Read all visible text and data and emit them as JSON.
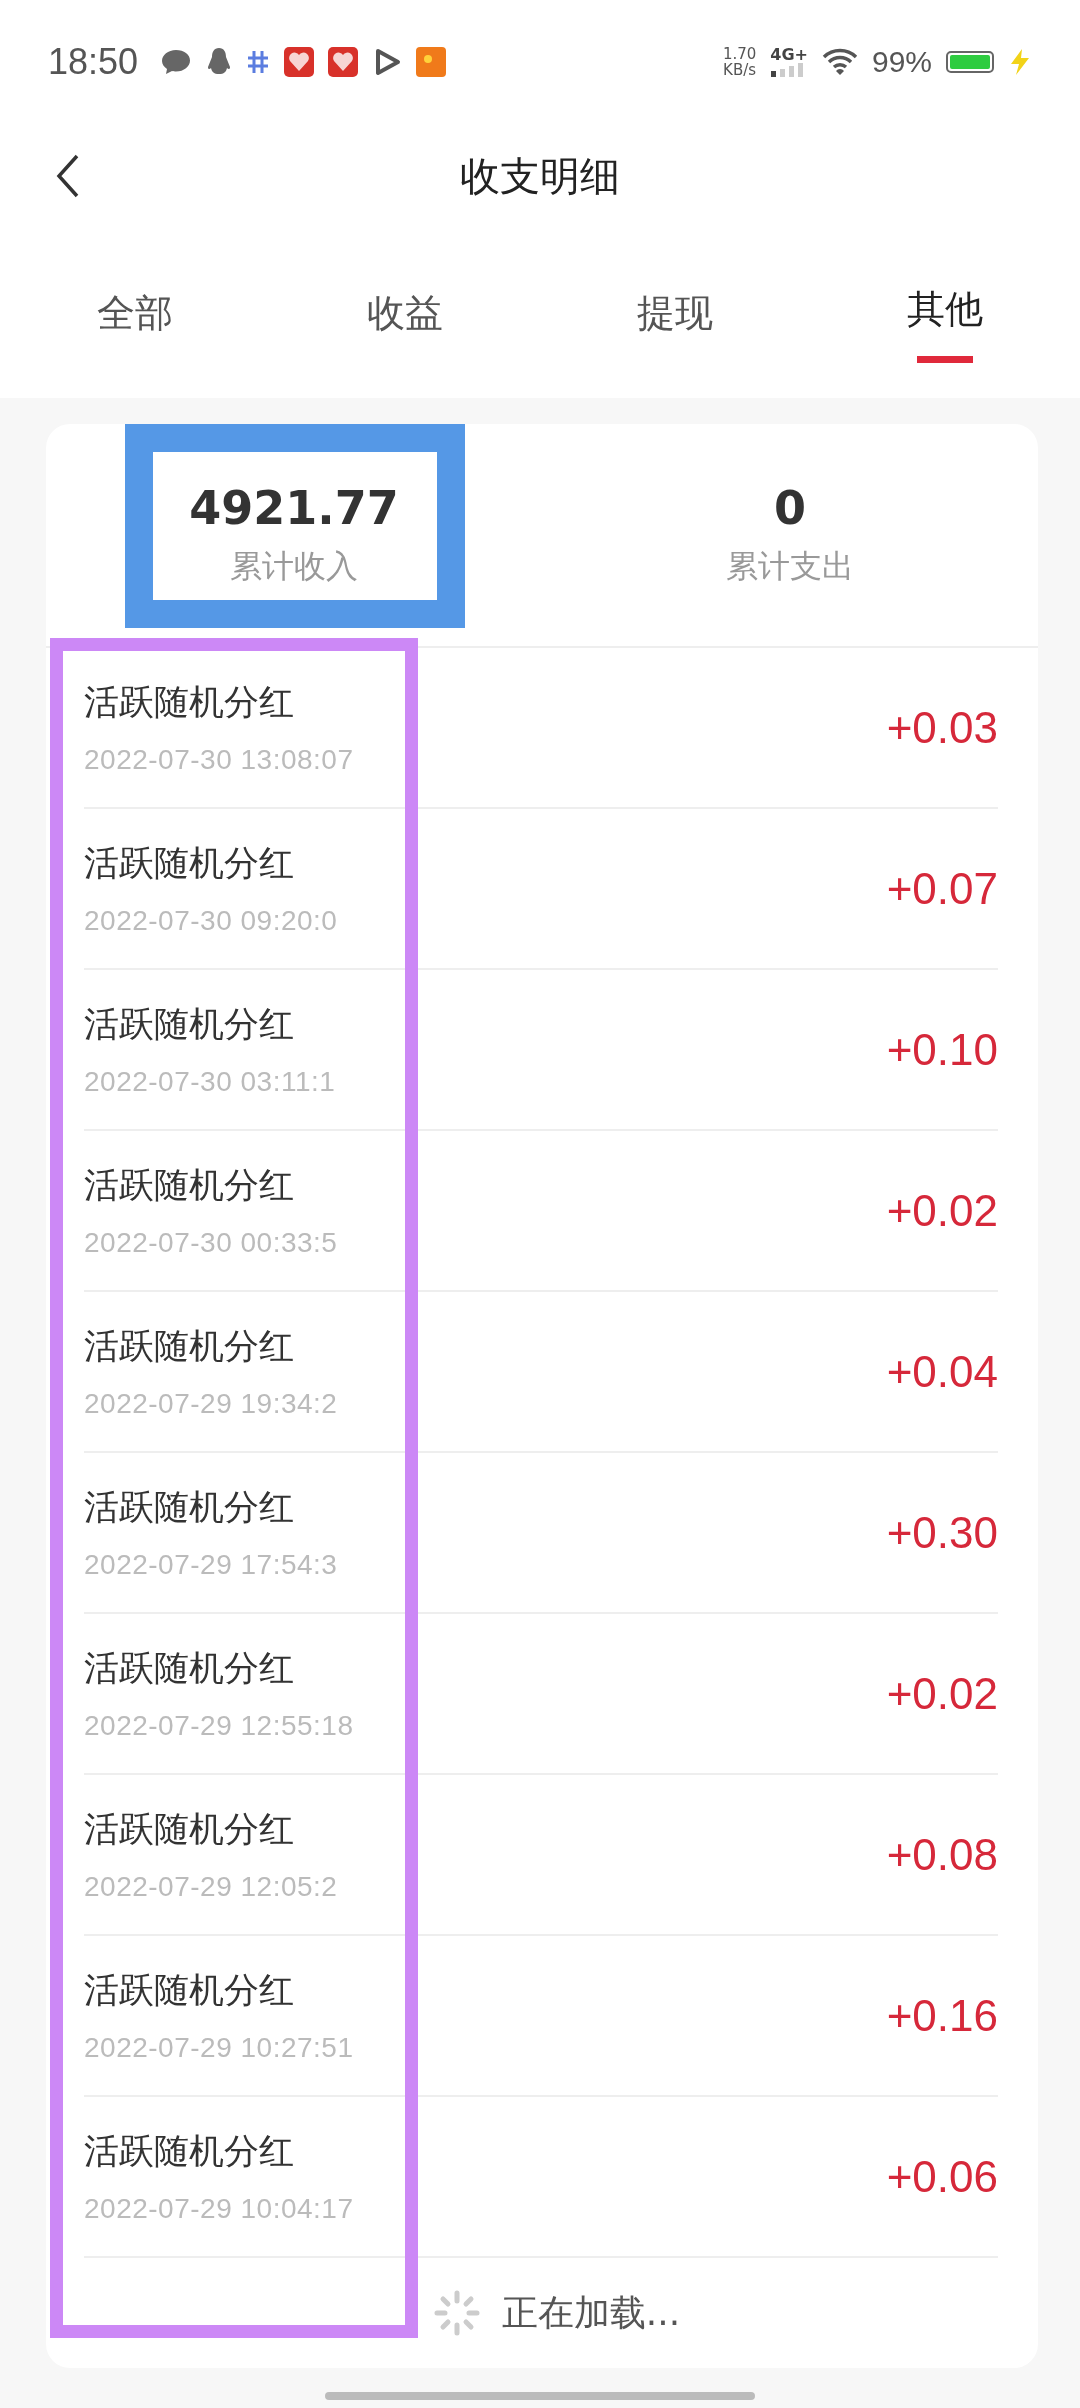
{
  "status_bar": {
    "time": "18:50",
    "speed_value": "1.70",
    "speed_unit": "KB/s",
    "network": "4G+",
    "battery": "99%"
  },
  "header": {
    "title": "收支明细"
  },
  "tabs": [
    {
      "label": "全部",
      "selected": false
    },
    {
      "label": "收益",
      "selected": false
    },
    {
      "label": "提现",
      "selected": false
    },
    {
      "label": "其他",
      "selected": true
    }
  ],
  "summary": [
    {
      "value": "4921.77",
      "label": "累计收入"
    },
    {
      "value": "0",
      "label": "累计支出"
    }
  ],
  "records": [
    {
      "title": "活跃随机分红",
      "time": "2022-07-30 13:08:07",
      "amount": "+0.03"
    },
    {
      "title": "活跃随机分红",
      "time": "2022-07-30 09:20:0",
      "amount": "+0.07"
    },
    {
      "title": "活跃随机分红",
      "time": "2022-07-30 03:11:1",
      "amount": "+0.10"
    },
    {
      "title": "活跃随机分红",
      "time": "2022-07-30 00:33:5",
      "amount": "+0.02"
    },
    {
      "title": "活跃随机分红",
      "time": "2022-07-29 19:34:2",
      "amount": "+0.04"
    },
    {
      "title": "活跃随机分红",
      "time": "2022-07-29 17:54:3",
      "amount": "+0.30"
    },
    {
      "title": "活跃随机分红",
      "time": "2022-07-29 12:55:18",
      "amount": "+0.02"
    },
    {
      "title": "活跃随机分红",
      "time": "2022-07-29 12:05:2",
      "amount": "+0.08"
    },
    {
      "title": "活跃随机分红",
      "time": "2022-07-29 10:27:51",
      "amount": "+0.16"
    },
    {
      "title": "活跃随机分红",
      "time": "2022-07-29 10:04:17",
      "amount": "+0.06"
    }
  ],
  "loading": {
    "text": "正在加载..."
  }
}
